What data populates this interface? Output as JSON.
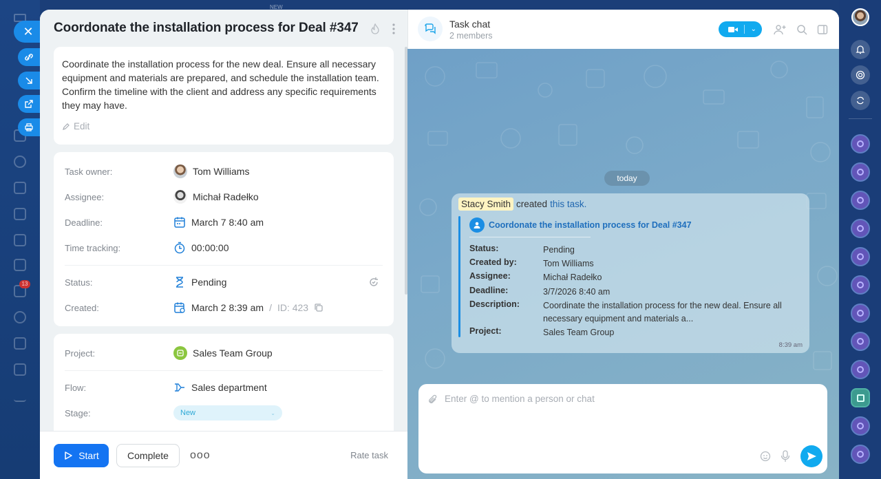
{
  "background_app": {
    "new_label": "NEW",
    "mail_badge": "13"
  },
  "task": {
    "title": "Coordonate the installation process for Deal #347",
    "description": "Coordinate the installation process for the new deal. Ensure all necessary equipment and materials are prepared, and schedule the installation team. Confirm the timeline with the client and address any specific requirements they may have.",
    "edit_label": "Edit",
    "fields": {
      "owner_label": "Task owner:",
      "owner_value": "Tom Williams",
      "assignee_label": "Assignee:",
      "assignee_value": "Michał Radełko",
      "deadline_label": "Deadline:",
      "deadline_value": "March 7 8:40 am",
      "tracking_label": "Time tracking:",
      "tracking_value": "00:00:00",
      "status_label": "Status:",
      "status_value": "Pending",
      "created_label": "Created:",
      "created_value": "March 2 8:39 am",
      "id_sep": "/",
      "id_value": "ID: 423"
    },
    "project": {
      "project_label": "Project:",
      "project_value": "Sales Team Group",
      "flow_label": "Flow:",
      "flow_value": "Sales department",
      "stage_label": "Stage:",
      "stage_value": "New"
    },
    "footer": {
      "start_label": "Start",
      "complete_label": "Complete",
      "more_label": "ooo",
      "rate_label": "Rate task"
    }
  },
  "chat": {
    "title": "Task chat",
    "members": "2 members",
    "today_label": "today",
    "message": {
      "author": "Stacy Smith",
      "action": "created",
      "link": "this task.",
      "quote_title": "Coordonate the installation process for Deal #347",
      "rows": [
        {
          "k": "Status:",
          "v": "Pending"
        },
        {
          "k": "Created by:",
          "v": "Tom Williams"
        },
        {
          "k": "Assignee:",
          "v": "Michał Radełko"
        },
        {
          "k": "Deadline:",
          "v": "3/7/2026 8:40 am"
        },
        {
          "k": "Description:",
          "v": "Coordinate the installation process for the new deal. Ensure all necessary equipment and materials a..."
        },
        {
          "k": "Project:",
          "v": "Sales Team Group"
        }
      ],
      "time": "8:39 am"
    },
    "composer_placeholder": "Enter @ to mention a person or chat"
  },
  "colors": {
    "accent": "#1474f2",
    "chat_accent": "#11aaef",
    "link": "#1f6fbd"
  }
}
